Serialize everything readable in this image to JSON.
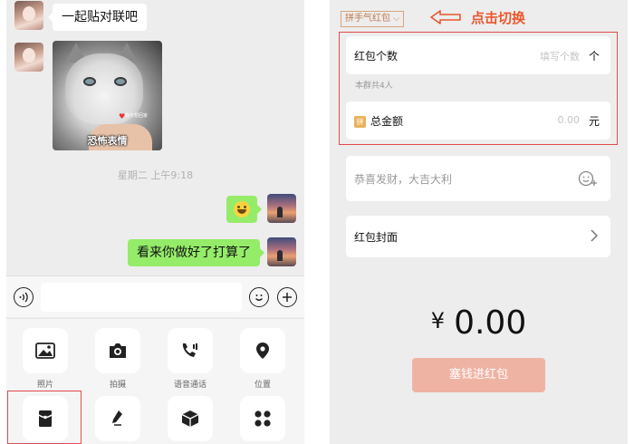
{
  "chat": {
    "msg_couplet": "一起贴对联吧",
    "cat_caption": "恐怖表情",
    "cat_small_text": "我不想回家",
    "timestamp": "星期二 上午9:18",
    "msg_emoji": "😄",
    "msg_reply": "看来你做好了打算了"
  },
  "toolbar": {
    "items": [
      {
        "label": "照片",
        "icon": "image-icon"
      },
      {
        "label": "拍摄",
        "icon": "camera-icon"
      },
      {
        "label": "语音通话",
        "icon": "phone-icon"
      },
      {
        "label": "位置",
        "icon": "location-icon"
      },
      {
        "label": "",
        "icon": "red-packet-icon"
      },
      {
        "label": "",
        "icon": "microphone-icon"
      },
      {
        "label": "",
        "icon": "box-icon"
      },
      {
        "label": "",
        "icon": "grid-icon"
      }
    ]
  },
  "redpacket": {
    "type_label": "拼手气红包",
    "hint": "点击切换",
    "count_label": "红包个数",
    "count_placeholder": "填写个数",
    "count_unit": "个",
    "group_note": "本群共4人",
    "pin_badge": "拼",
    "total_label": "总金额",
    "total_value": "0.00",
    "total_unit": "元",
    "greeting_placeholder": "恭喜发财，大吉大利",
    "cover_label": "红包封面",
    "currency": "¥",
    "amount": "0.00",
    "send_label": "塞钱进红包"
  },
  "colors": {
    "chat_bg": "#ededed",
    "bubble_green": "#95ec69",
    "highlight_red": "#e04b4b",
    "hint_orange": "#e8572e",
    "send_button": "#efb3a4"
  }
}
